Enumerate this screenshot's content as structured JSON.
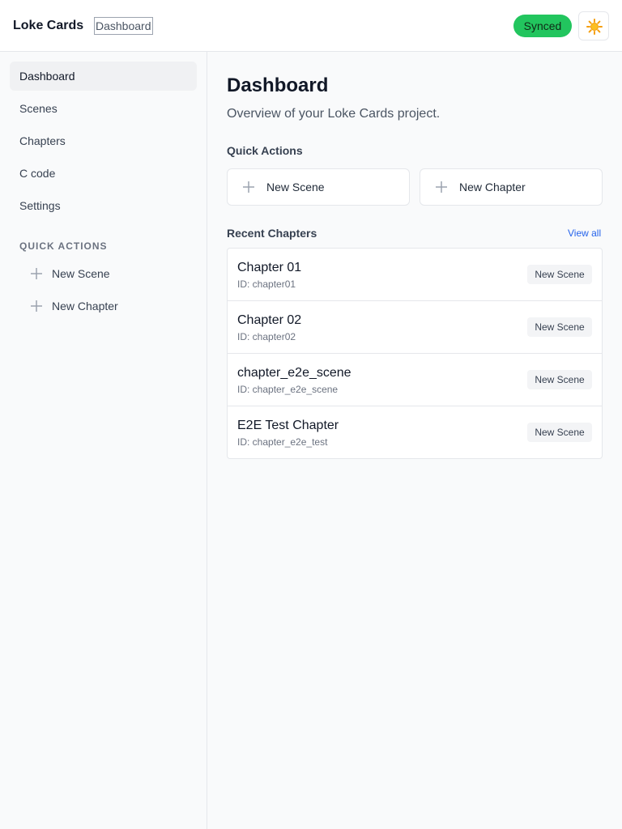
{
  "header": {
    "brand": "Loke Cards",
    "breadcrumb": "Dashboard",
    "sync_status": "Synced",
    "theme_icon": "sun-icon",
    "colors": {
      "synced": "#22c55e",
      "link": "#2563eb"
    }
  },
  "sidebar": {
    "items": [
      {
        "label": "Dashboard",
        "active": true
      },
      {
        "label": "Scenes"
      },
      {
        "label": "Chapters"
      },
      {
        "label": "C code"
      },
      {
        "label": "Settings"
      }
    ],
    "quick_actions_heading": "QUICK ACTIONS",
    "quick_actions": [
      {
        "label": "New Scene",
        "icon": "plus-icon"
      },
      {
        "label": "New Chapter",
        "icon": "plus-icon"
      }
    ]
  },
  "main": {
    "title": "Dashboard",
    "subtitle": "Overview of your Loke Cards project.",
    "quick_actions_title": "Quick Actions",
    "quick_actions": [
      {
        "label": "New Scene",
        "icon": "plus-icon"
      },
      {
        "label": "New Chapter",
        "icon": "plus-icon"
      }
    ],
    "recent_title": "Recent Chapters",
    "view_all": "View all",
    "chapters": [
      {
        "title": "Chapter 01",
        "id": "ID: chapter01",
        "action": "New Scene"
      },
      {
        "title": "Chapter 02",
        "id": "ID: chapter02",
        "action": "New Scene"
      },
      {
        "title": "chapter_e2e_scene",
        "id": "ID: chapter_e2e_scene",
        "action": "New Scene"
      },
      {
        "title": "E2E Test Chapter",
        "id": "ID: chapter_e2e_test",
        "action": "New Scene"
      }
    ]
  }
}
